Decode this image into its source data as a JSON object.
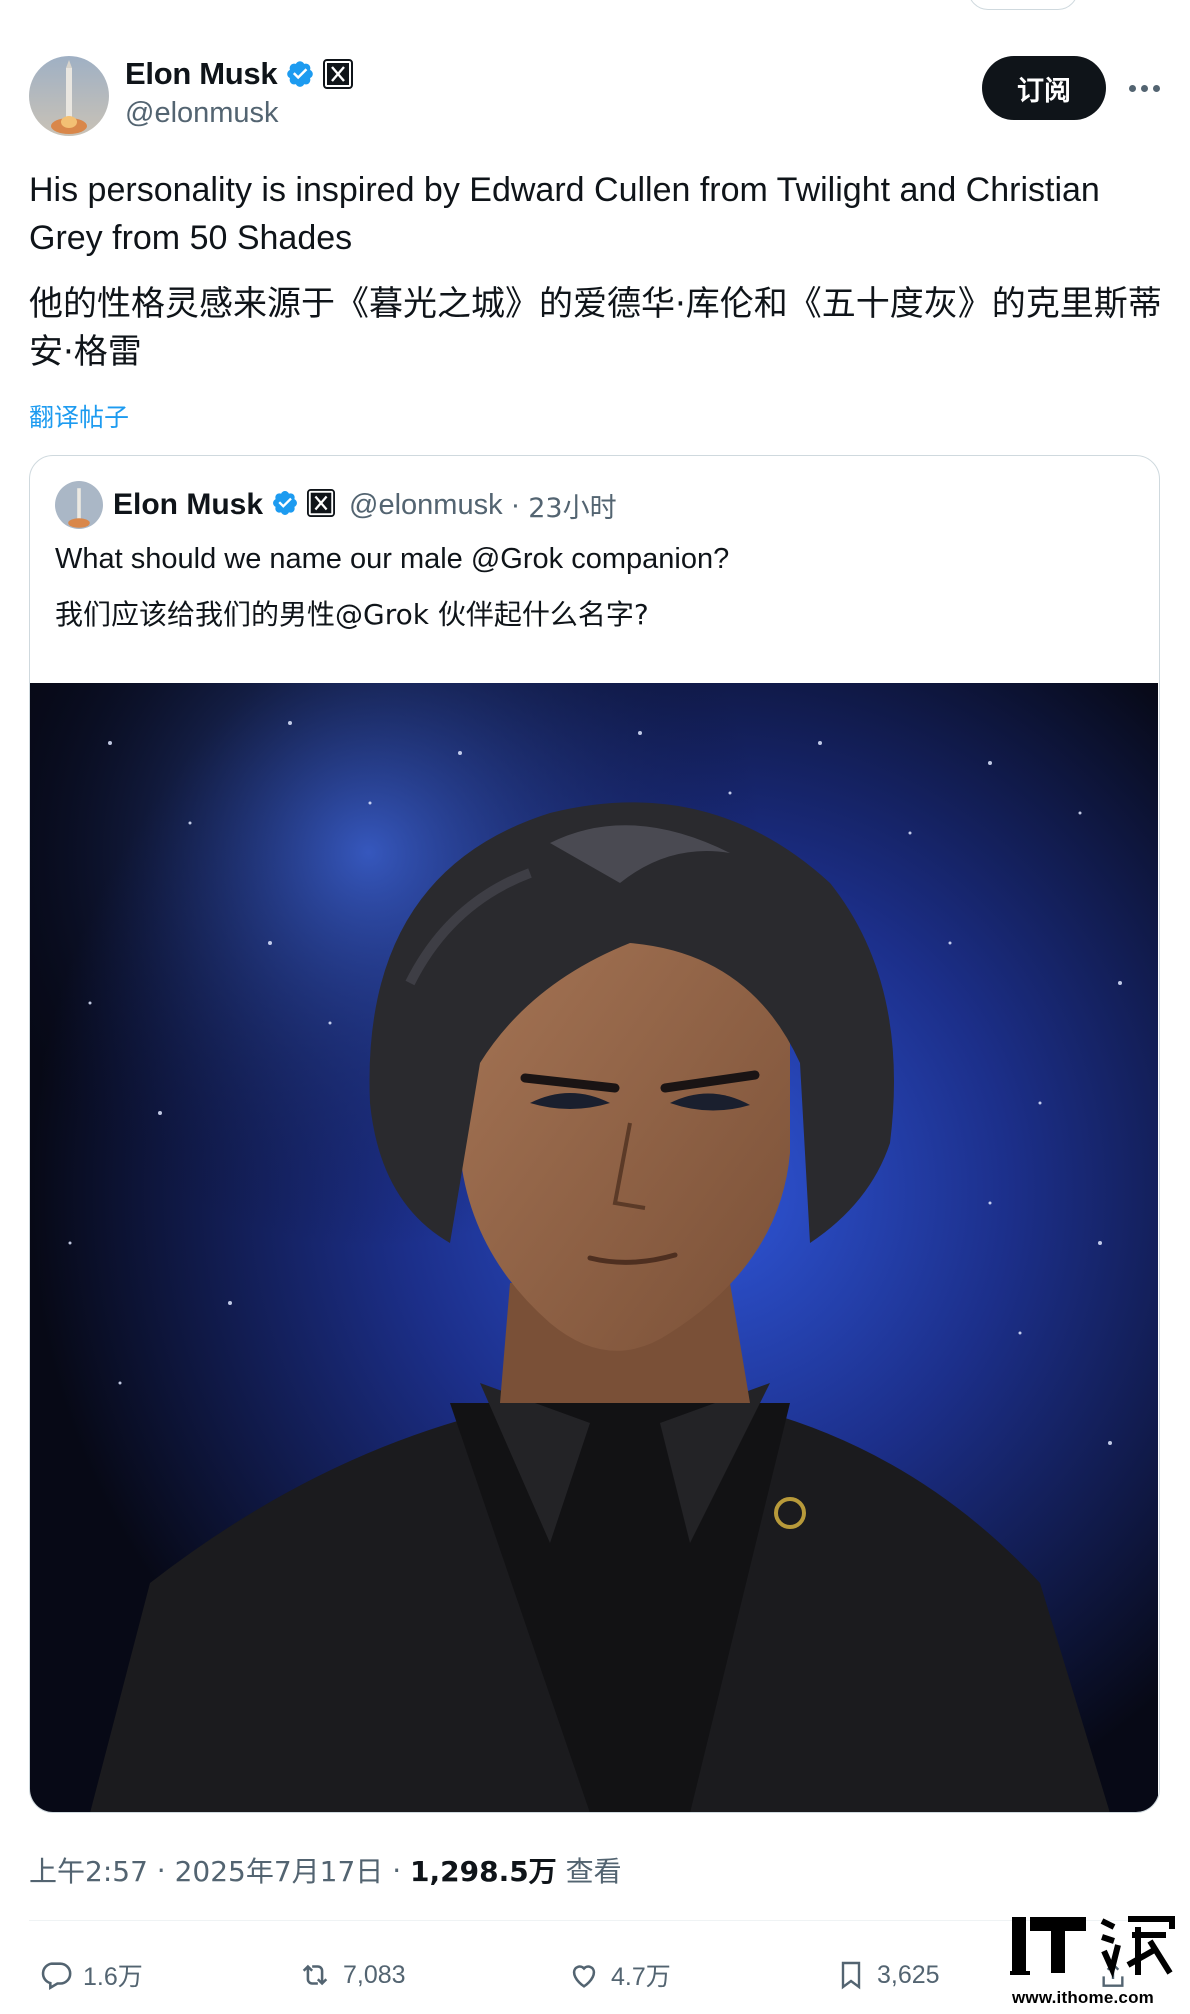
{
  "author": {
    "name": "Elon Musk",
    "handle": "@elonmusk"
  },
  "subscribe_label": "订阅",
  "tweet": {
    "text_en": "His personality is inspired by Edward Cullen from Twilight and Christian Grey from 50 Shades",
    "text_zh": "他的性格灵感来源于《暮光之城》的爱德华·库伦和《五十度灰》的克里斯蒂安·格雷",
    "translate_label": "翻译帖子"
  },
  "quoted": {
    "name": "Elon Musk",
    "handle": "@elonmusk",
    "separator": "·",
    "time": "23小时",
    "text_en": "What should we name our male @Grok companion?",
    "text_zh": "我们应该给我们的男性@Grok 伙伴起什么名字?"
  },
  "meta": {
    "time": "上午2:57",
    "sep1": " · ",
    "date": "2025年7月17日",
    "sep2": " · ",
    "views": "1,298.5万",
    "views_label": " 查看"
  },
  "actions": {
    "replies": "1.6万",
    "reposts": "7,083",
    "likes": "4.7万",
    "bookmarks": "3,625"
  },
  "icons": {
    "verified": "verified-badge-icon",
    "x_logo": "x-logo-icon",
    "more": "more-dots-icon",
    "reply": "reply-icon",
    "repost": "repost-icon",
    "like": "heart-icon",
    "bookmark": "bookmark-icon",
    "share": "share-icon"
  },
  "colors": {
    "accent": "#1d9bf0",
    "text": "#0f1419",
    "secondary": "#536471",
    "button_bg": "#0f1419"
  },
  "watermark": {
    "url": "www.ithome.com"
  }
}
